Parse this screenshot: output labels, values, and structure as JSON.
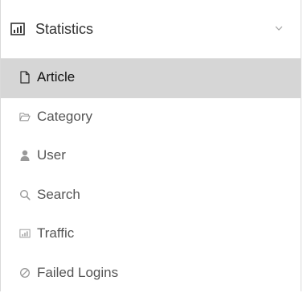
{
  "section": {
    "title": "Statistics",
    "icon": "bar-chart-icon",
    "toggle_icon": "chevron-down-icon",
    "expanded": true
  },
  "menu": {
    "active_index": 0,
    "items": [
      {
        "label": "Article",
        "icon": "file-icon"
      },
      {
        "label": "Category",
        "icon": "folder-open-icon"
      },
      {
        "label": "User",
        "icon": "user-icon"
      },
      {
        "label": "Search",
        "icon": "search-icon"
      },
      {
        "label": "Traffic",
        "icon": "bar-chart-icon"
      },
      {
        "label": "Failed Logins",
        "icon": "ban-icon"
      }
    ]
  },
  "colors": {
    "active_background": "#d6d6d6",
    "text": "#555555",
    "icon": "#999999"
  }
}
